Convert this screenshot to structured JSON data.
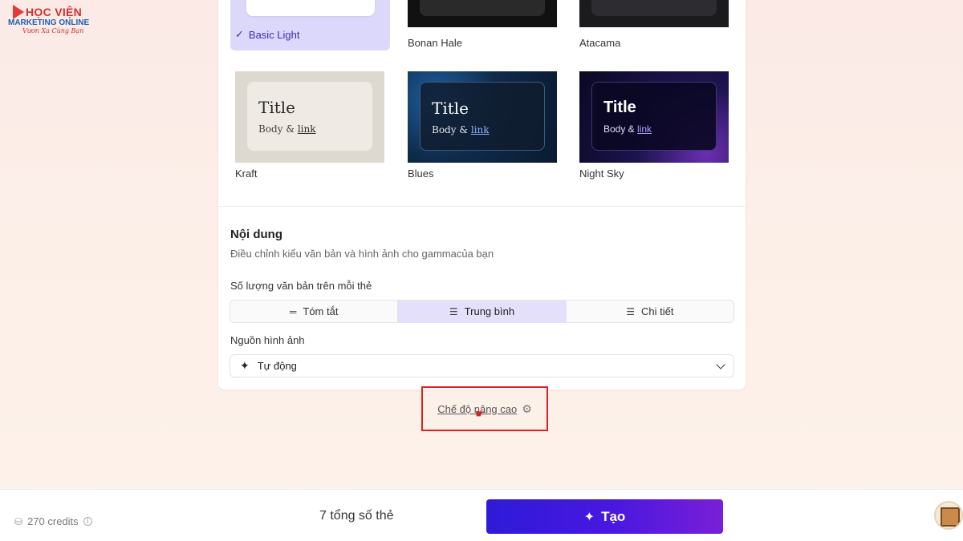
{
  "logo": {
    "title": "HỌC VIỆN",
    "subtitle": "MARKETING ONLINE",
    "tagline": "Vươn Xa Cùng Bạn"
  },
  "themes": {
    "top_row": [
      {
        "name": "Basic Light",
        "selected": true
      },
      {
        "name": "Bonan Hale"
      },
      {
        "name": "Atacama"
      }
    ],
    "bottom_row": [
      {
        "name": "Kraft",
        "card_title": "Title",
        "card_body": "Body &",
        "card_link": "link",
        "bg": "#ddd8d0",
        "card_bg": "#efebe4",
        "title_color": "#2b2b2b",
        "link_color": "#2b2b2b"
      },
      {
        "name": "Blues",
        "card_title": "Title",
        "card_body": "Body &",
        "card_link": "link",
        "bg": "#0f2a4a",
        "card_bg": "#132235",
        "title_color": "#ffffff",
        "link_color": "#8ab4ff"
      },
      {
        "name": "Night Sky",
        "card_title": "Title",
        "card_body": "Body &",
        "card_link": "link",
        "bg": "#14103a",
        "card_bg": "#0d0b2a",
        "title_color": "#ffffff",
        "link_color": "#b09cff"
      }
    ]
  },
  "content": {
    "title": "Nội dung",
    "description": "Điều chỉnh kiểu văn bản và hình ảnh cho gammacủa bạn",
    "text_amount_label": "Số lượng văn bản trên mỗi thẻ",
    "text_amount_options": [
      {
        "label": "Tóm tắt",
        "icon": "≡",
        "active": false
      },
      {
        "label": "Trung bình",
        "icon": "≡",
        "active": true
      },
      {
        "label": "Chi tiết",
        "icon": "≡",
        "active": false
      }
    ],
    "image_source_label": "Nguồn hình ảnh",
    "image_source_value": "Tự động"
  },
  "advanced": {
    "label": "Chế độ nâng cao"
  },
  "footer": {
    "credits": "270 credits",
    "cards_count": "7 tổng số thẻ",
    "create_label": "Tạo"
  },
  "colors": {
    "accent": "#4a18e0",
    "selected_bg": "#dcd8fb",
    "highlight_box": "#e02020"
  }
}
